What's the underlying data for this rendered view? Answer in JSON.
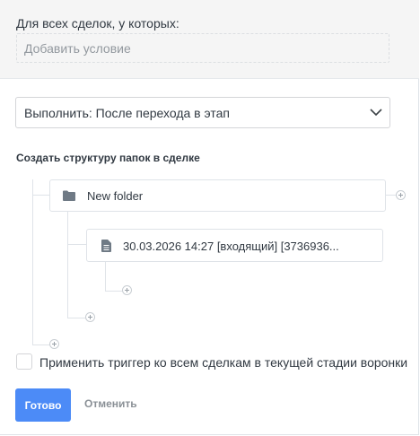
{
  "conditions": {
    "label": "Для всех сделок, у которых:",
    "add_placeholder": "Добавить условие"
  },
  "execute": {
    "value": "Выполнить: После перехода в этап"
  },
  "structure": {
    "title": "Создать структуру папок в сделке",
    "folder": {
      "label": "New folder",
      "icon": "folder-icon"
    },
    "file": {
      "label": "30.03.2026 14:27 [входящий] [3736936...",
      "icon": "document-icon"
    }
  },
  "apply_all": {
    "label": "Применить триггер ко всем сделкам в текущей стадии воронки",
    "checked": false
  },
  "actions": {
    "done": "Готово",
    "cancel": "Отменить"
  },
  "colors": {
    "primary": "#4c8bf7",
    "section_bg": "#f5f5f5",
    "text": "#313942",
    "muted": "#8a9096"
  }
}
